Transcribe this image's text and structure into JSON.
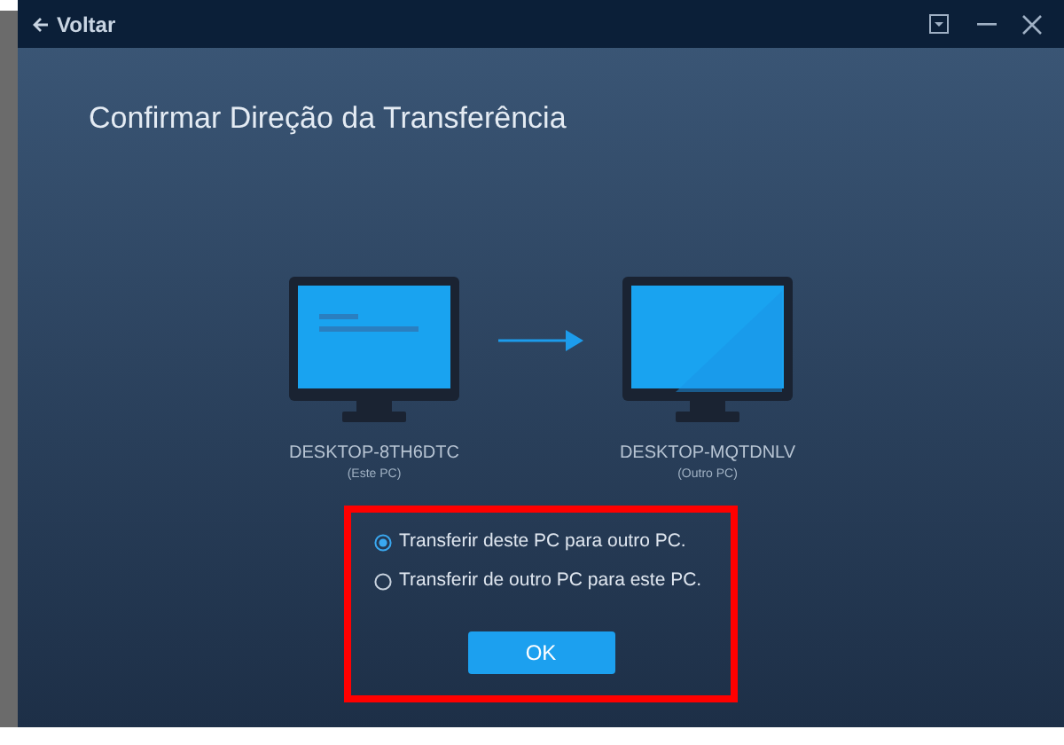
{
  "title_bar": {
    "back_label": "Voltar"
  },
  "heading": "Confirmar Direção da Transferência",
  "computers": [
    {
      "name": "DESKTOP-8TH6DTC",
      "role": "(Este PC)",
      "kind": "source"
    },
    {
      "name": "DESKTOP-MQTDNLV",
      "role": "(Outro PC)",
      "kind": "target"
    }
  ],
  "options": [
    {
      "label": "Transferir deste PC para outro PC.",
      "selected": true
    },
    {
      "label": "Transferir de outro PC para este PC.",
      "selected": false
    }
  ],
  "ok_button": "OK"
}
